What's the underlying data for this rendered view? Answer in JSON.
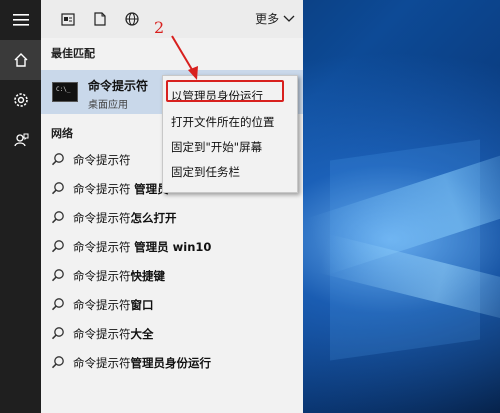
{
  "rail": {
    "icons": [
      "hamburger-menu-icon",
      "home-icon",
      "gear-icon",
      "feedback-icon"
    ]
  },
  "topbar": {
    "icons": [
      "documents-icon",
      "file-icon",
      "web-globe-icon"
    ],
    "more_label": "更多"
  },
  "best_match": {
    "section_label": "最佳匹配",
    "title": "命令提示符",
    "subtitle": "桌面应用",
    "icon_text": "C:\\_"
  },
  "context_menu": {
    "items": [
      "以管理员身份运行",
      "打开文件所在的位置",
      "固定到\"开始\"屏幕",
      "固定到任务栏"
    ]
  },
  "web": {
    "section_label": "网络",
    "results": [
      {
        "plain": "命令提示符",
        "bold": ""
      },
      {
        "plain": "命令提示符 ",
        "bold": "管理员"
      },
      {
        "plain": "命令提示符",
        "bold": "怎么打开"
      },
      {
        "plain": "命令提示符 ",
        "bold": "管理员 win10"
      },
      {
        "plain": "命令提示符",
        "bold": "快捷键"
      },
      {
        "plain": "命令提示符",
        "bold": "窗口"
      },
      {
        "plain": "命令提示符",
        "bold": "大全"
      },
      {
        "plain": "命令提示符",
        "bold": "管理员身份运行"
      }
    ]
  },
  "annotation": {
    "number": "2",
    "color": "#d8201e"
  }
}
